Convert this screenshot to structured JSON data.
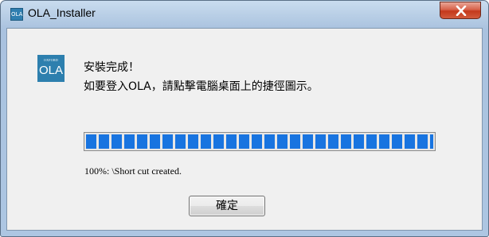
{
  "window": {
    "title": "OLA_Installer",
    "app_icon_text": "OLA",
    "close_icon": "close-x-icon"
  },
  "logo": {
    "brand_small": "OXFORD",
    "brand_main": "OLA"
  },
  "message": {
    "line1": "安裝完成！",
    "line2": "如要登入OLA，請點擊電腦桌面上的捷徑圖示。"
  },
  "progress": {
    "percent": 100,
    "status_text": "100%: \\Short cut created."
  },
  "buttons": {
    "ok_label": "確定"
  },
  "colors": {
    "progress_fill": "#1874e0",
    "close_button": "#c4391c",
    "title_bar": "#b9cfe6"
  }
}
